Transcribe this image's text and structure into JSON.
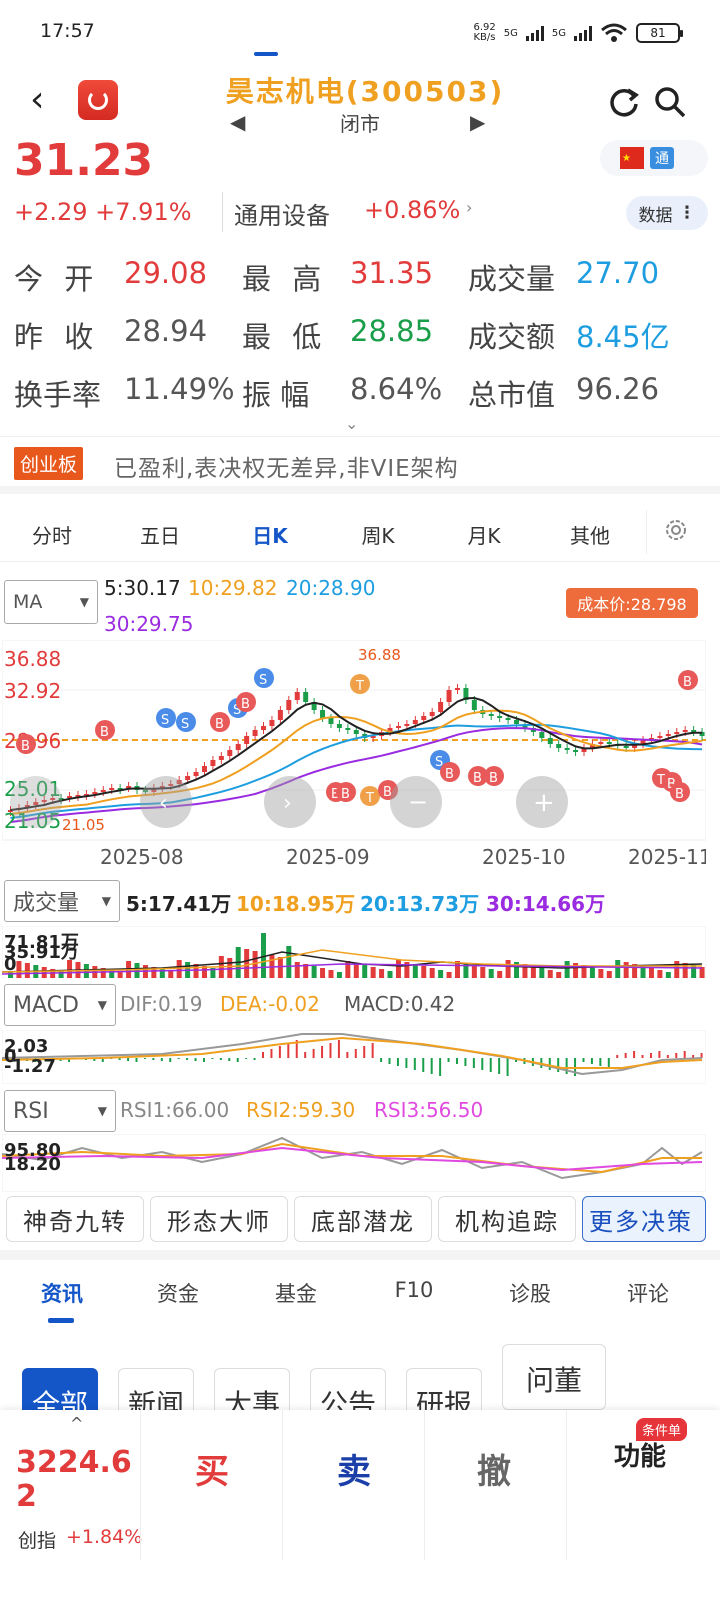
{
  "status_bar": {
    "time": "17:57",
    "net_speed": "6.92\nKB/s",
    "net1": "5G",
    "net2": "5G",
    "battery": "81"
  },
  "header": {
    "stock_name": "昊志机电(300503)",
    "market_status": "闭市"
  },
  "quote": {
    "price": "31.23",
    "change": "+2.29 +7.91%",
    "sector": "通用设备",
    "sector_change": "+0.86%",
    "tong_label": "通",
    "data_label": "数据"
  },
  "stats": {
    "open_label": "今 开",
    "open": "29.08",
    "high_label": "最 高",
    "high": "31.35",
    "volume_label": "成交量",
    "volume": "27.70",
    "prev_close_label": "昨 收",
    "prev_close": "28.94",
    "low_label": "最 低",
    "low": "28.85",
    "amount_label": "成交额",
    "amount": "8.45亿",
    "turnover_label": "换手率",
    "turnover": "11.49%",
    "amplitude_label": "振 幅",
    "amplitude": "8.64%",
    "mktcap_label": "总市值",
    "mktcap": "96.26"
  },
  "board": {
    "badge": "创业板",
    "desc": "已盈利,表决权无差异,非VIE架构"
  },
  "chart_tabs": [
    "分时",
    "五日",
    "日K",
    "周K",
    "月K",
    "其他"
  ],
  "ma_legend": {
    "selector": "MA",
    "ma5": "5:30.17",
    "ma10": "10:29.82",
    "ma20": "20:28.90",
    "ma30": "30:29.75",
    "cost_badge": "成本价:28.798"
  },
  "kline_axis": {
    "y_labels": [
      "36.88",
      "32.92",
      "28.96",
      "25.01",
      "21.05"
    ],
    "x_labels": [
      "2025-08",
      "2025-09",
      "2025-10",
      "2025-11"
    ],
    "high_marker": "36.88",
    "low_marker": "21.05"
  },
  "volume_legend": {
    "selector": "成交量",
    "v5": "5:17.41万",
    "v10": "10:18.95万",
    "v20": "20:13.73万",
    "v30": "30:14.66万",
    "y_top": "71.81万",
    "y_mid": "35.91万",
    "y_zero": "0"
  },
  "macd_legend": {
    "selector": "MACD",
    "dif": "DIF:0.19",
    "dea": "DEA:-0.02",
    "macd": "MACD:0.42",
    "y_top": "2.03",
    "y_zero": "0",
    "y_bottom": "-1.27"
  },
  "rsi_legend": {
    "selector": "RSI",
    "rsi1": "RSI1:66.00",
    "rsi2": "RSI2:59.30",
    "rsi3": "RSI3:56.50",
    "y_top": "95.80",
    "y_bottom": "18.20"
  },
  "quick_tools": [
    "神奇九转",
    "形态大师",
    "底部潜龙",
    "机构追踪",
    "更多决策"
  ],
  "info_tabs": [
    "资讯",
    "资金",
    "基金",
    "F10",
    "诊股",
    "评论"
  ],
  "news_chips": [
    "全部",
    "新闻",
    "大事",
    "公告",
    "研报",
    "问董"
  ],
  "bottom_bar": {
    "index_value": "3224.62",
    "index_name": "创指",
    "index_change": "+1.84%",
    "buy": "买",
    "sell": "卖",
    "cancel": "撤",
    "function": "功能",
    "cond_badge": "条件单"
  },
  "colors": {
    "up": "#e23b3b",
    "down": "#1a9e4a",
    "accent": "#1456c8",
    "ma5": "#222222",
    "ma10": "#f0a020",
    "ma20": "#1e9ee0",
    "ma30": "#9a2be0"
  }
}
